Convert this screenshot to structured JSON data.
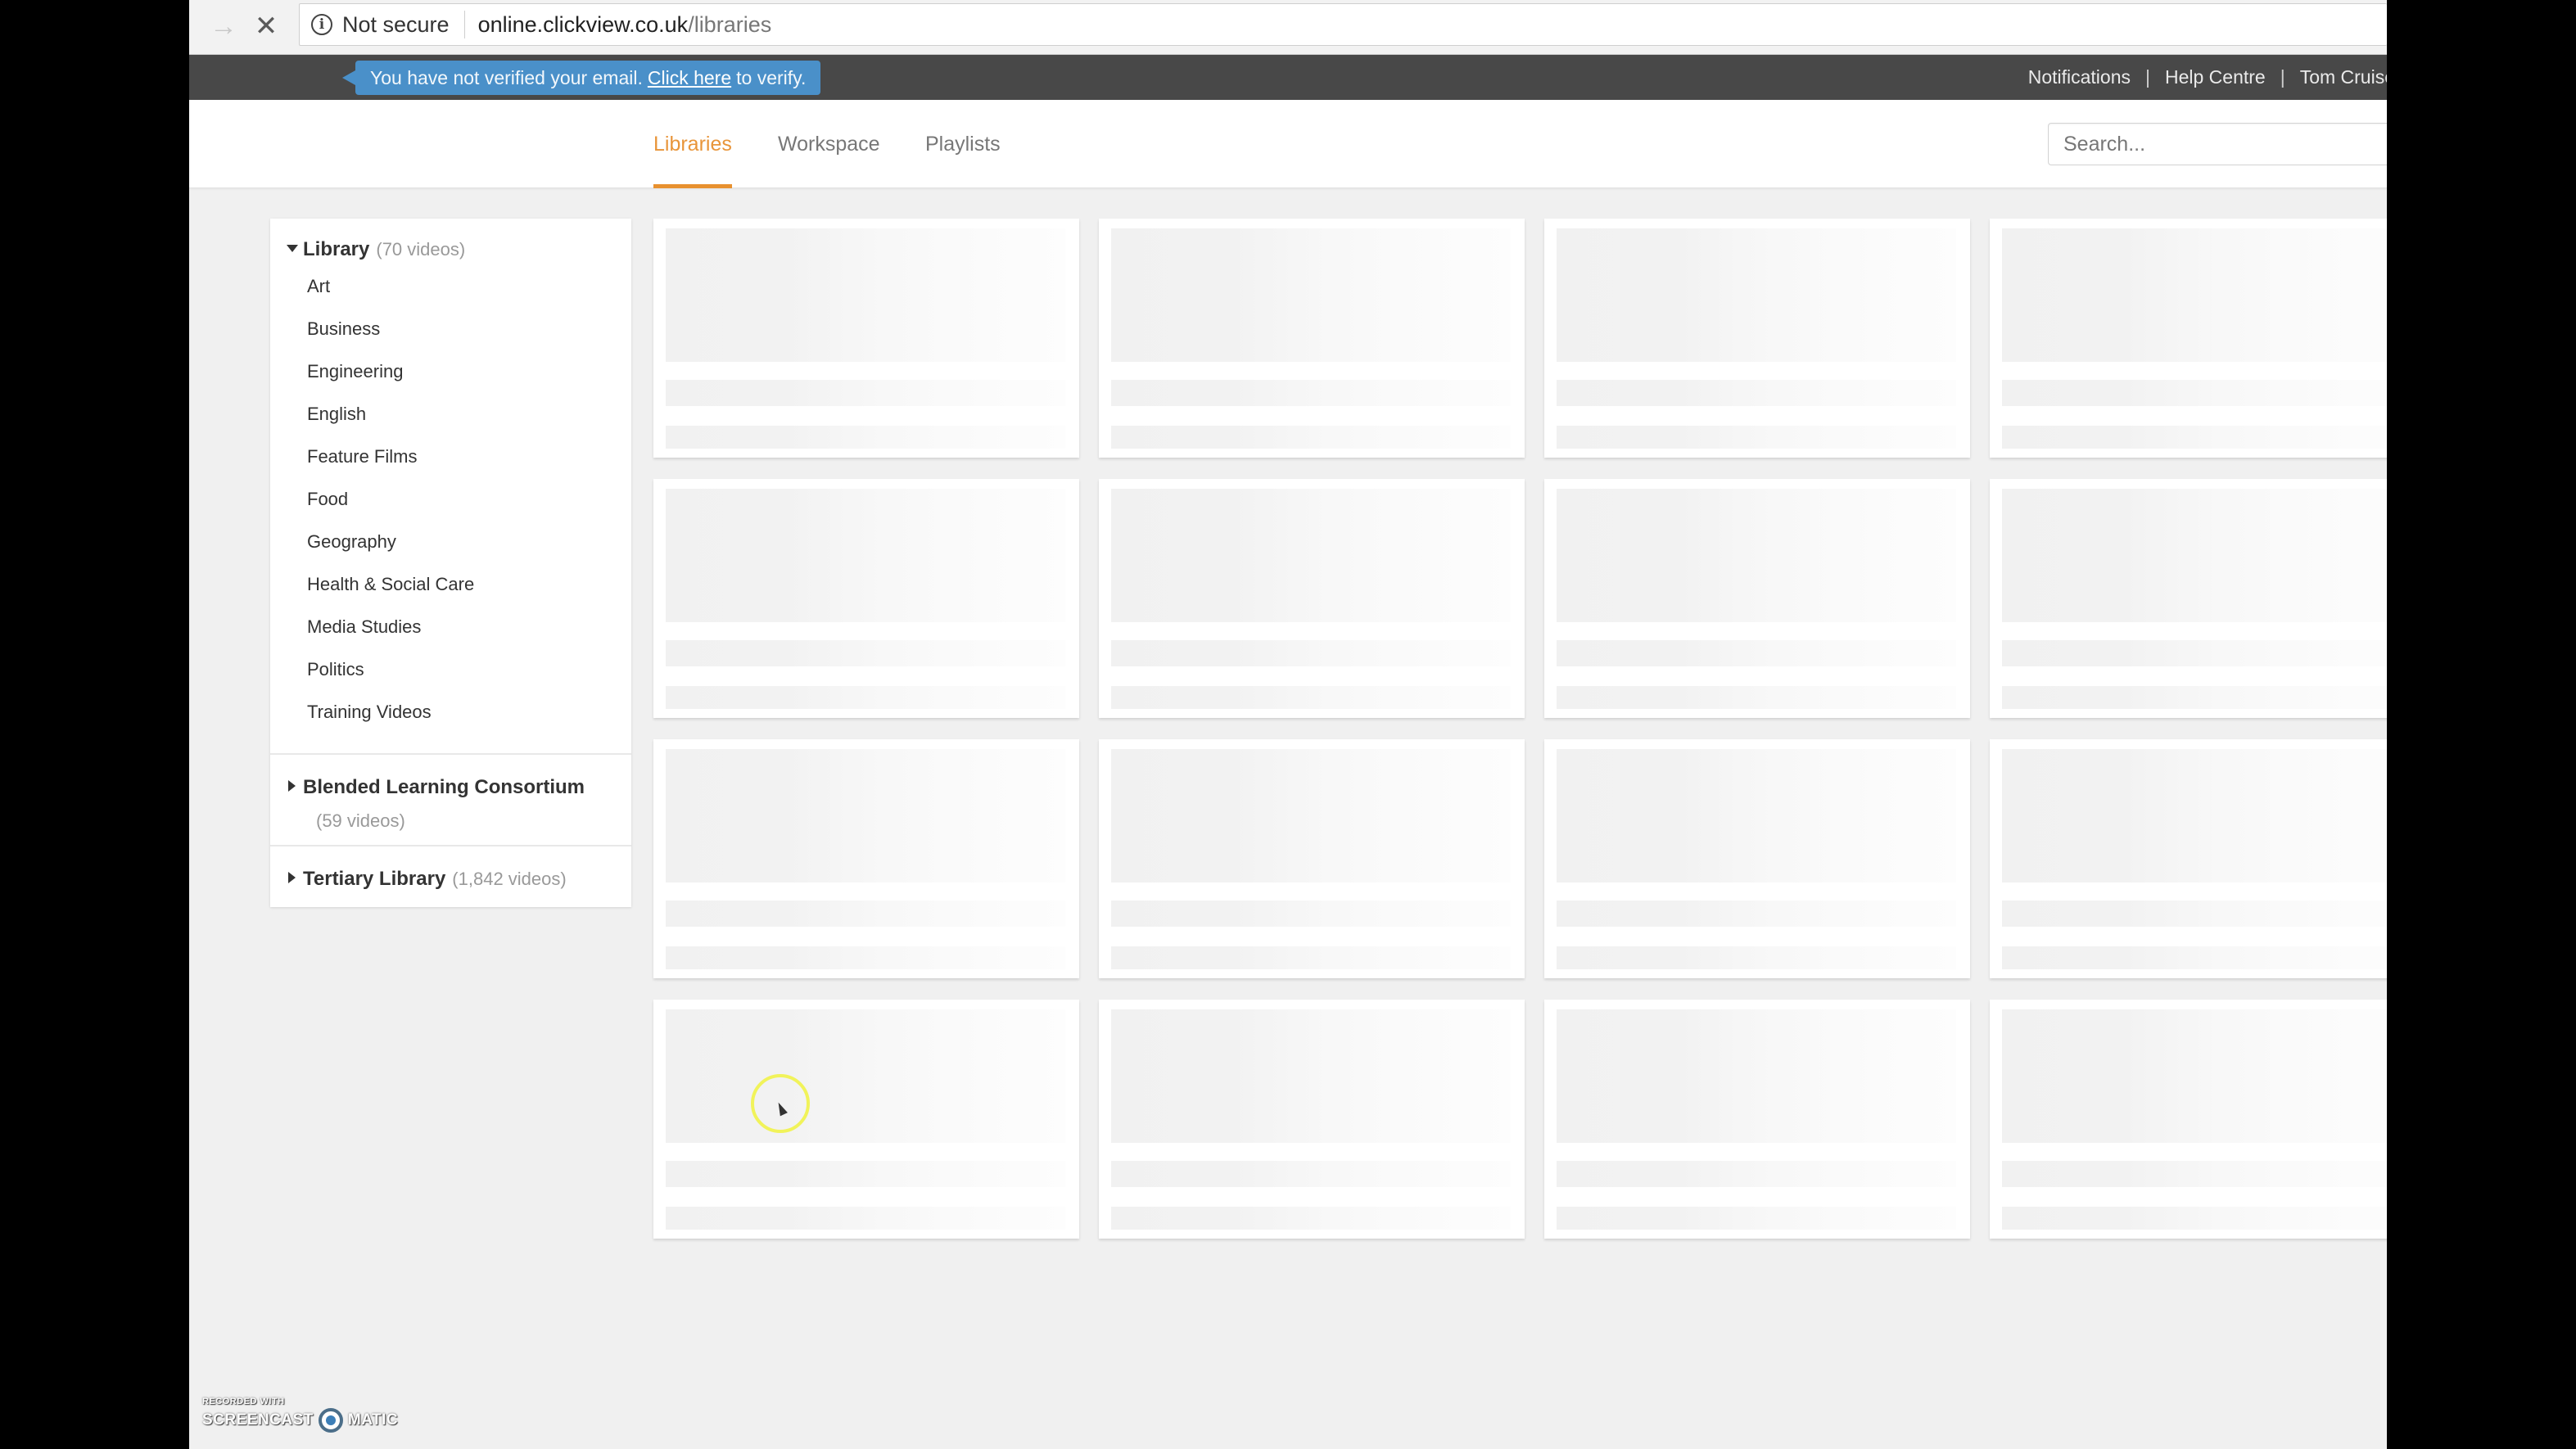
{
  "browser": {
    "forward_icon": "arrow-right-icon",
    "stop_icon": "close-icon",
    "security_label": "Not secure",
    "url_host": "online.clickview.co.uk",
    "url_path": "/libraries"
  },
  "topbar": {
    "verify_prefix": "You have not verified your email.",
    "verify_link": "Click here",
    "verify_suffix": "to verify.",
    "links": [
      "Notifications",
      "Help Centre",
      "Tom Cruise"
    ],
    "separator": "|",
    "colors": {
      "bar": "#484848",
      "tooltip": "#4a90c9"
    }
  },
  "nav": {
    "tabs": [
      {
        "label": "Libraries",
        "active": true
      },
      {
        "label": "Workspace",
        "active": false
      },
      {
        "label": "Playlists",
        "active": false
      }
    ],
    "search_placeholder": "Search...",
    "active_color": "#e8953a"
  },
  "sidebar": {
    "libraries": [
      {
        "name": "Library",
        "count": "(70 videos)",
        "expanded": true,
        "categories": [
          "Art",
          "Business",
          "Engineering",
          "English",
          "Feature Films",
          "Food",
          "Geography",
          "Health & Social Care",
          "Media Studies",
          "Politics",
          "Training Videos"
        ]
      },
      {
        "name": "Blended Learning Consortium",
        "count": "(59 videos)",
        "expanded": false
      },
      {
        "name": "Tertiary Library",
        "count": "(1,842 videos)",
        "expanded": false
      }
    ]
  },
  "content": {
    "state": "loading",
    "placeholder_cards": 16
  },
  "watermark": {
    "line1": "RECORDED WITH",
    "line2_left": "SCREENCAST",
    "line2_right": "MATIC"
  }
}
